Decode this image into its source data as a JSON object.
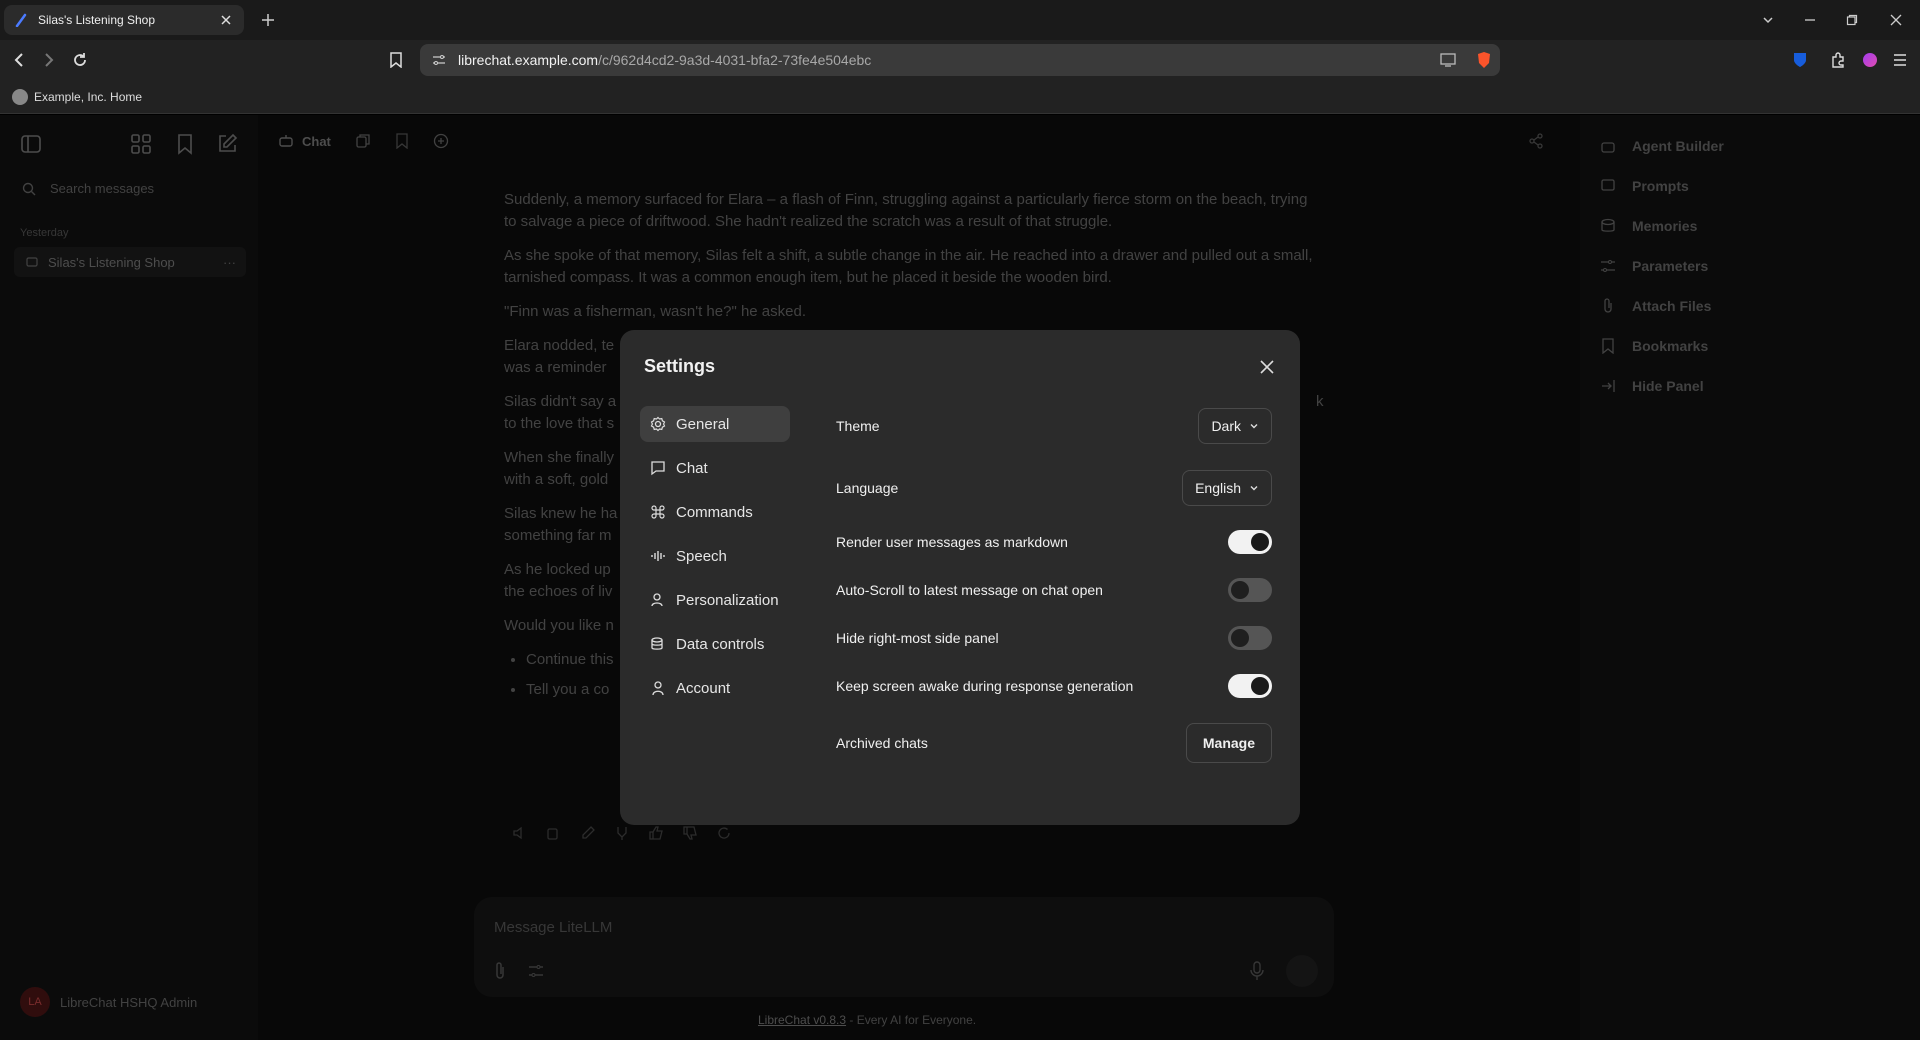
{
  "browser": {
    "tab_title": "Silas's Listening Shop",
    "url_host": "librechat.example.com",
    "url_path": "/c/962d4cd2-9a3d-4031-bfa2-73fe4e504ebc",
    "bookmark": "Example, Inc. Home"
  },
  "sidebar": {
    "search_placeholder": "Search messages",
    "group_label": "Yesterday",
    "conversation_title": "Silas's Listening Shop",
    "user_initials": "LA",
    "user_name": "LibreChat HSHQ Admin"
  },
  "topbar": {
    "chat_label": "Chat"
  },
  "messages": {
    "paragraphs": [
      "Suddenly, a memory surfaced for Elara – a flash of Finn, struggling against a particularly fierce storm on the beach, trying to salvage a piece of driftwood.  She hadn't realized the scratch was a result of that struggle.",
      "As she spoke of that memory, Silas felt a shift, a subtle change in the air. He reached into a drawer and pulled out a small, tarnished compass. It was a common enough item, but he placed it beside the wooden bird.",
      "\"Finn was a fisherman, wasn't he?\" he asked.",
      "Elara nodded, te",
      "was a reminder",
      "Silas didn't say a",
      "to the love that s",
      "When she finally",
      "with a soft, gold",
      "Silas knew he ha",
      "something far m",
      "As he locked up",
      "the echoes of liv",
      "Would you like n"
    ],
    "bullets": [
      "Continue this",
      "Tell you a co"
    ],
    "trailing_k": "k"
  },
  "composer": {
    "placeholder": "Message LiteLLM"
  },
  "footer": {
    "link": "LibreChat v0.8.3",
    "text": " - Every AI for Everyone."
  },
  "right_panel": {
    "items": [
      "Agent Builder",
      "Prompts",
      "Memories",
      "Parameters",
      "Attach Files",
      "Bookmarks",
      "Hide Panel"
    ]
  },
  "settings": {
    "title": "Settings",
    "nav": [
      {
        "label": "General",
        "icon": "gear-icon",
        "active": true
      },
      {
        "label": "Chat",
        "icon": "message-icon"
      },
      {
        "label": "Commands",
        "icon": "command-icon"
      },
      {
        "label": "Speech",
        "icon": "waveform-icon"
      },
      {
        "label": "Personalization",
        "icon": "person-icon"
      },
      {
        "label": "Data controls",
        "icon": "database-icon"
      },
      {
        "label": "Account",
        "icon": "user-icon"
      }
    ],
    "theme": {
      "label": "Theme",
      "value": "Dark"
    },
    "language": {
      "label": "Language",
      "value": "English"
    },
    "toggles": [
      {
        "label": "Render user messages as markdown",
        "on": true
      },
      {
        "label": "Auto-Scroll to latest message on chat open",
        "on": false
      },
      {
        "label": "Hide right-most side panel",
        "on": false
      },
      {
        "label": "Keep screen awake during response generation",
        "on": true
      }
    ],
    "archived": {
      "label": "Archived chats",
      "button": "Manage"
    }
  },
  "colors": {
    "brave_orange": "#fb542b",
    "dialog_bg": "#2b2b2b",
    "toggle_on": "#f2f2f2"
  }
}
